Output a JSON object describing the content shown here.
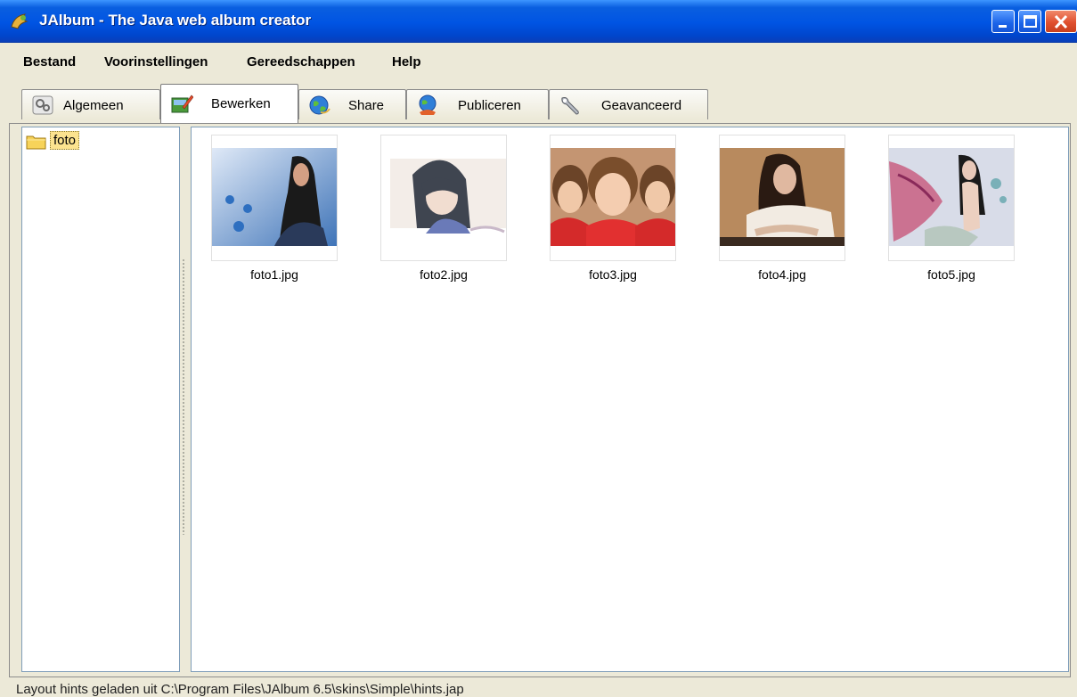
{
  "window": {
    "title": "JAlbum - The Java web album creator",
    "title_color": "#ffffff",
    "titlebar_color": "#0054e3"
  },
  "menu": [
    "Bestand",
    "Voorinstellingen",
    "Gereedschappen",
    "Help"
  ],
  "tabs": [
    {
      "label": "Algemeen",
      "icon": "settings-icon",
      "active": false
    },
    {
      "label": "Bewerken",
      "icon": "edit-photo-icon",
      "active": true
    },
    {
      "label": "Share",
      "icon": "globe-share-icon",
      "active": false
    },
    {
      "label": "Publiceren",
      "icon": "globe-publish-icon",
      "active": false
    },
    {
      "label": "Geavanceerd",
      "icon": "wrench-icon",
      "active": false
    }
  ],
  "tree": {
    "items": [
      {
        "label": "foto",
        "icon": "folder-icon",
        "selected": true
      }
    ],
    "selection_color": "#fce38f"
  },
  "thumbnails": [
    {
      "filename": "foto1.jpg"
    },
    {
      "filename": "foto2.jpg"
    },
    {
      "filename": "foto3.jpg"
    },
    {
      "filename": "foto4.jpg"
    },
    {
      "filename": "foto5.jpg"
    }
  ],
  "status": {
    "text": "Layout hints geladen uit C:\\Program Files\\JAlbum 6.5\\skins\\Simple\\hints.jap"
  }
}
